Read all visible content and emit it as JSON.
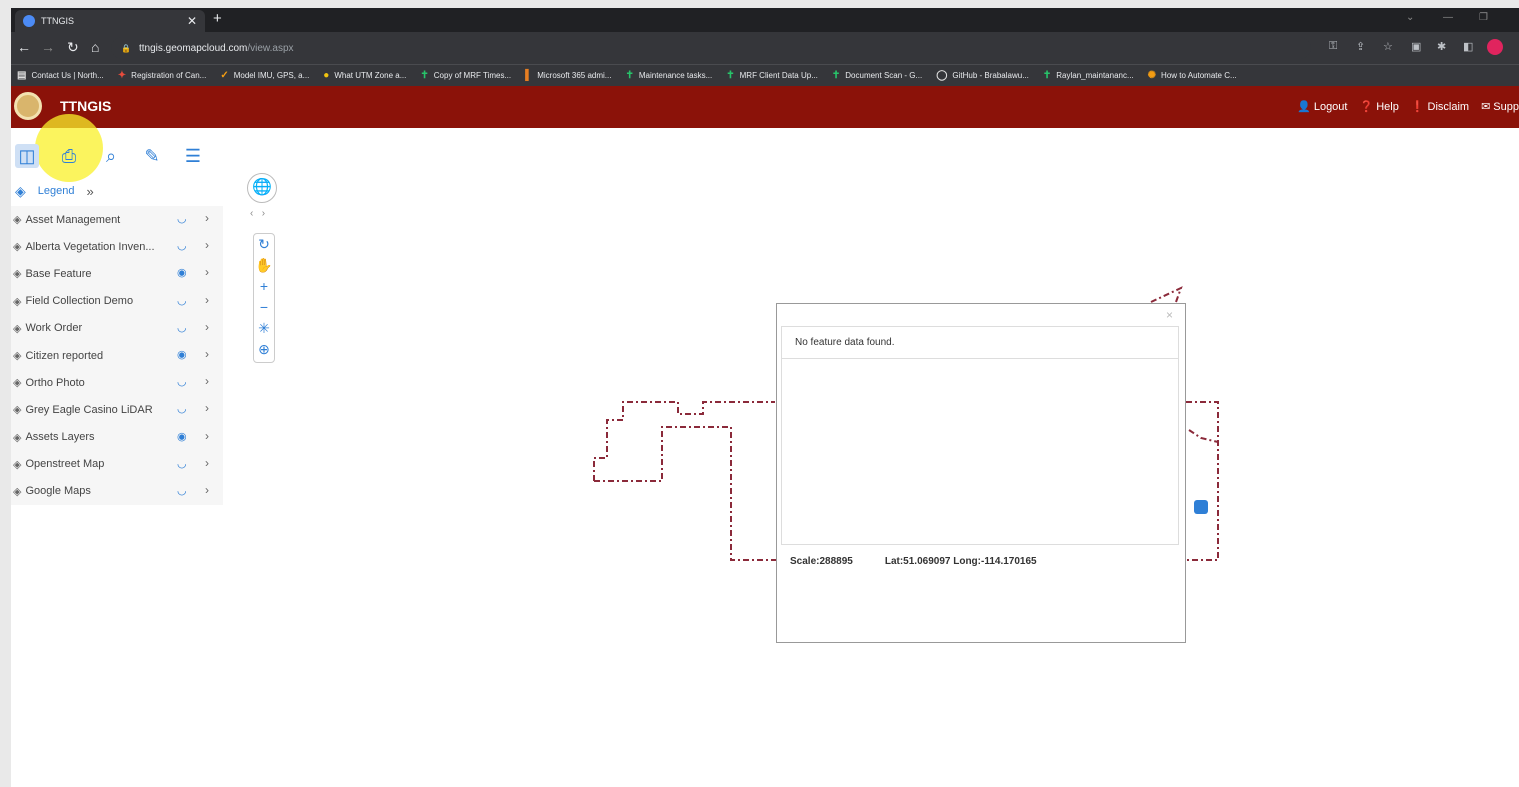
{
  "browser": {
    "tab_title": "TTNGIS",
    "url_host": "ttngis.geomapcloud.com",
    "url_path": "/view.aspx",
    "bookmarks": [
      "Contact Us | North...",
      "Registration of Can...",
      "Model IMU, GPS, a...",
      "What UTM Zone a...",
      "Copy of MRF Times...",
      "Microsoft 365 admi...",
      "Maintenance tasks...",
      "MRF Client Data Up...",
      "Document Scan - G...",
      "GitHub - Brabalawu...",
      "Raylan_maintananc...",
      "How to Automate C..."
    ]
  },
  "app": {
    "title": "TTNGIS",
    "header_links": [
      "Logout",
      "Help",
      "Disclaim",
      "Supp"
    ]
  },
  "panel": {
    "legend_label": "Legend",
    "layers": [
      {
        "name": "Asset Management",
        "visible": false
      },
      {
        "name": "Alberta Vegetation Inven...",
        "visible": false
      },
      {
        "name": "Base Feature",
        "visible": true
      },
      {
        "name": "Field Collection Demo",
        "visible": false
      },
      {
        "name": "Work Order",
        "visible": false
      },
      {
        "name": "Citizen reported",
        "visible": true
      },
      {
        "name": "Ortho Photo",
        "visible": false
      },
      {
        "name": "Grey Eagle Casino LiDAR",
        "visible": false
      },
      {
        "name": "Assets Layers",
        "visible": true
      },
      {
        "name": "Openstreet Map",
        "visible": false
      },
      {
        "name": "Google Maps",
        "visible": false
      }
    ]
  },
  "popup": {
    "message": "No feature data found.",
    "scale": "Scale:288895",
    "coords": "Lat:51.069097 Long:-114.170165"
  },
  "colors": {
    "header_bg": "#8b1209",
    "accent": "#2f7fd6",
    "boundary": "#8b2a3a"
  }
}
